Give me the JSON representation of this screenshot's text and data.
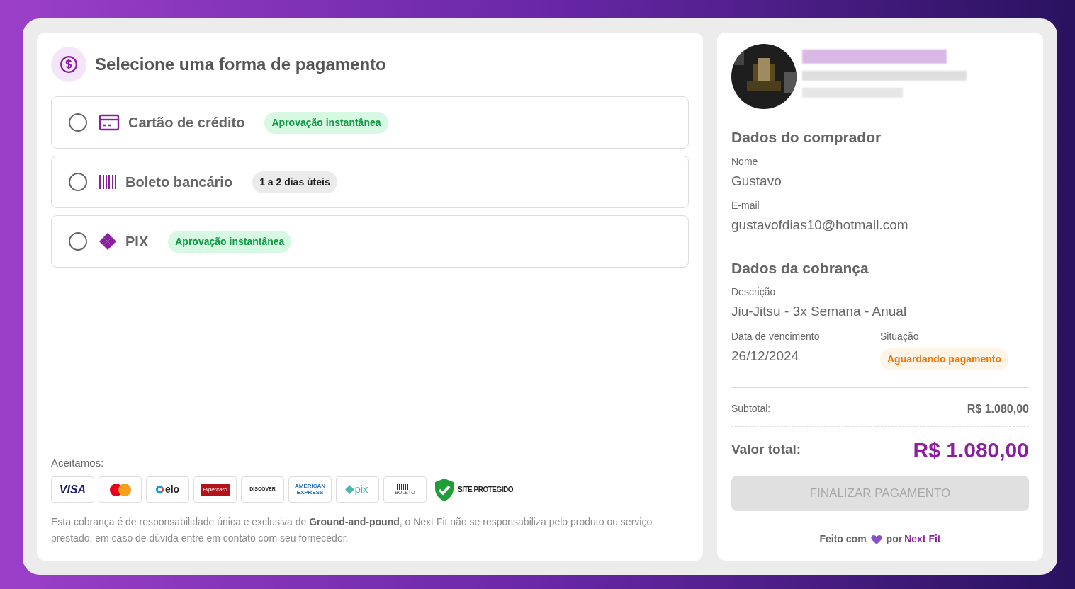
{
  "payment": {
    "title": "Selecione uma forma de pagamento",
    "options": [
      {
        "kind": "card",
        "label": "Cartão de crédito",
        "selected": false,
        "badge": {
          "text": "Aprovação instantânea",
          "kind": "success"
        }
      },
      {
        "kind": "boleto",
        "label": "Boleto bancário",
        "selected": false,
        "badge": {
          "text": "1 a 2 dias úteis",
          "kind": "neutral"
        }
      },
      {
        "kind": "pix",
        "label": "PIX",
        "selected": false,
        "badge": {
          "text": "Aprovação instantânea",
          "kind": "success"
        }
      }
    ],
    "accepted_label": "Aceitamos:",
    "brands": [
      {
        "kind": "visa",
        "text": "VISA"
      },
      {
        "kind": "mastercard"
      },
      {
        "kind": "elo",
        "text": "elo"
      },
      {
        "kind": "hipercard",
        "text": "Hipercard"
      },
      {
        "kind": "discover",
        "text": "DISCOVER"
      },
      {
        "kind": "amex",
        "text": "AMERICAN EXPRESS"
      },
      {
        "kind": "pix",
        "text": "pix"
      },
      {
        "kind": "boleto",
        "text": "BOLETO"
      }
    ],
    "seal": {
      "main": "SITE PROTEGIDO"
    },
    "disclaimer": "Esta cobrança é de responsabilidade única e exclusiva de **Ground-and-pound**, o Next Fit não se responsabiliza pelo produto ou serviço prestado, em caso de dúvida entre em contato com seu fornecedor."
  },
  "summary": {
    "buyer": {
      "title": "Dados do comprador",
      "fields": [
        {
          "label": "Nome",
          "value": "Gustavo"
        },
        {
          "label": "E-mail",
          "value": "gustavofdias10@hotmail.com"
        }
      ]
    },
    "charge": {
      "title": "Dados da cobrança",
      "description_label": "Descrição",
      "description": "Jiu-Jitsu - 3x Semana - Anual",
      "due_label": "Data de vencimento",
      "due": "26/12/2024",
      "status_label": "Situação",
      "status": {
        "text": "Aguardando pagamento",
        "kind": "warning"
      }
    },
    "subtotal_label": "Subtotal:",
    "subtotal": "R$ 1.080,00",
    "total_label": "Valor total:",
    "total": "R$ 1.080,00",
    "button": {
      "text": "FINALIZAR PAGAMENTO",
      "disabled": true
    },
    "footer": {
      "before": "Feito com",
      "middle": "por",
      "brand": "Next Fit"
    }
  }
}
